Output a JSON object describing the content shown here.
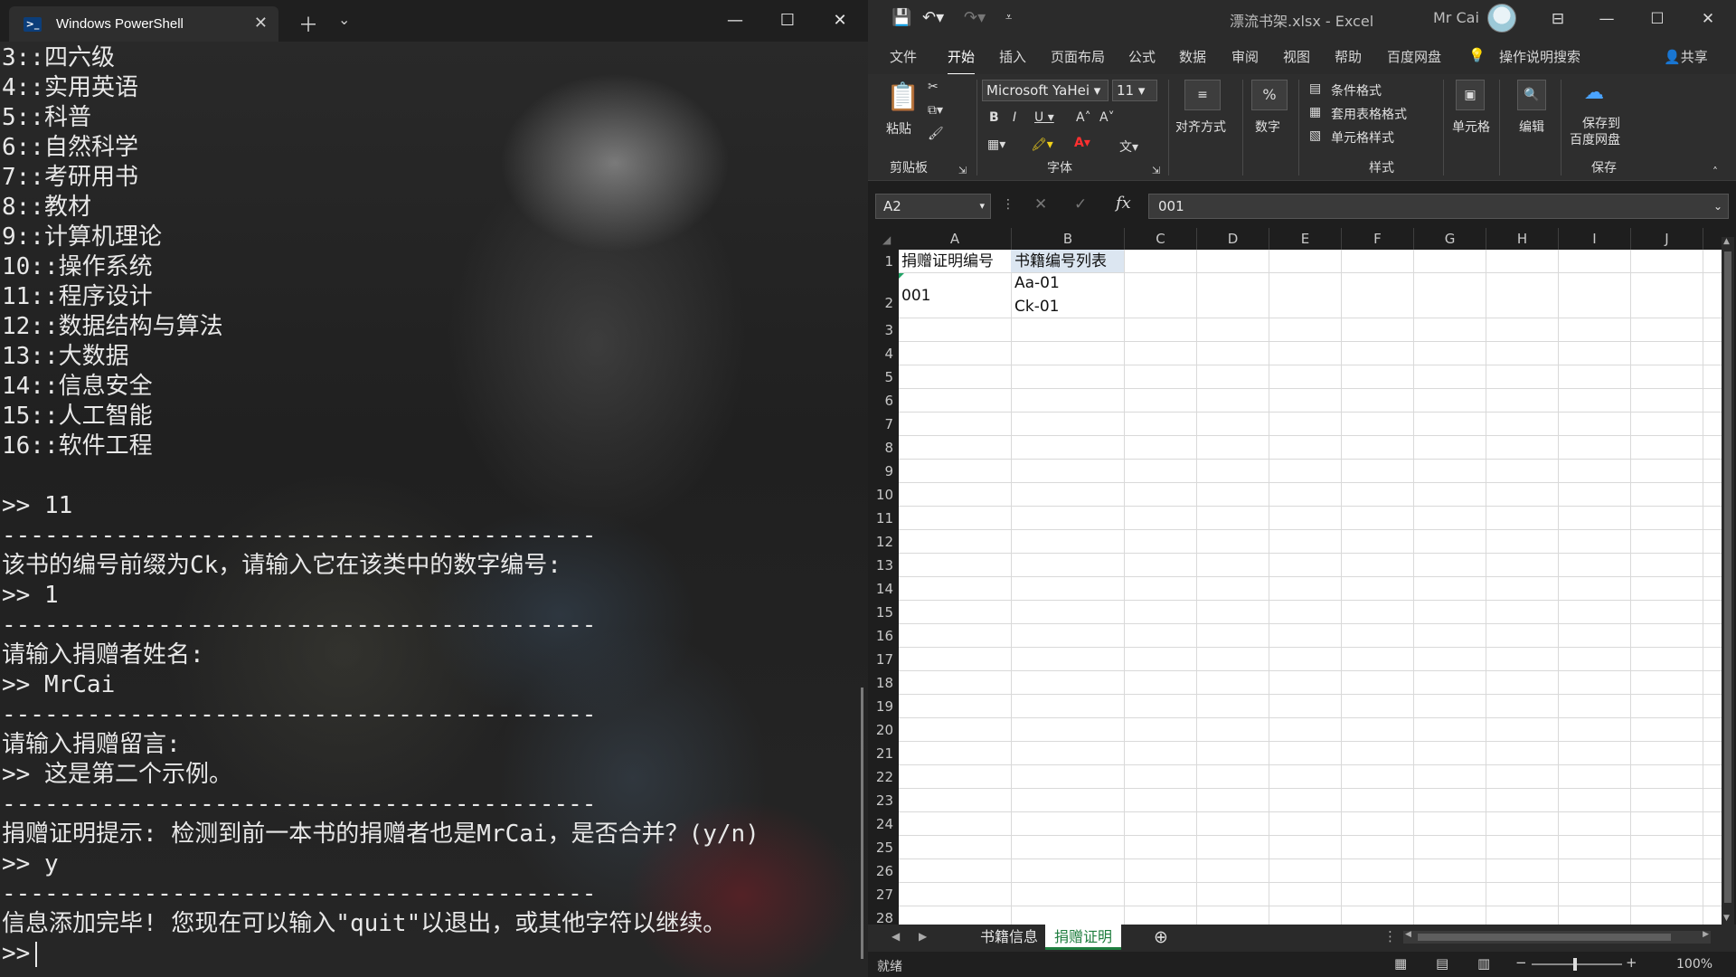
{
  "powershell": {
    "tab_title": "Windows PowerShell",
    "lines": [
      "3::四六级",
      "4::实用英语",
      "5::科普",
      "6::自然科学",
      "7::考研用书",
      "8::教材",
      "9::计算机理论",
      "10::操作系统",
      "11::程序设计",
      "12::数据结构与算法",
      "13::大数据",
      "14::信息安全",
      "15::人工智能",
      "16::软件工程",
      "",
      ">> 11",
      "------------------------------------------",
      "该书的编号前缀为Ck，请输入它在该类中的数字编号:",
      ">> 1",
      "------------------------------------------",
      "请输入捐赠者姓名:",
      ">> MrCai",
      "------------------------------------------",
      "请输入捐赠留言:",
      ">> 这是第二个示例。",
      "------------------------------------------",
      "捐赠证明提示: 检测到前一本书的捐赠者也是MrCai，是否合并？(y/n)",
      ">> y",
      "------------------------------------------",
      "信息添加完毕! 您现在可以输入\"quit\"以退出，或其他字符以继续。"
    ],
    "prompt": ">>"
  },
  "excel": {
    "filename": "漂流书架.xlsx - Excel",
    "user": "Mr Cai",
    "menu": [
      "文件",
      "开始",
      "插入",
      "页面布局",
      "公式",
      "数据",
      "审阅",
      "视图",
      "帮助",
      "百度网盘"
    ],
    "tell_me": "操作说明搜索",
    "share": "共享",
    "ribbon": {
      "paste": "粘贴",
      "clipboard_group": "剪贴板",
      "font_name": "Microsoft YaHei",
      "font_size": "11",
      "font_group": "字体",
      "align": "对齐方式",
      "number": "数字",
      "cond_format": "条件格式",
      "table_format": "套用表格格式",
      "cell_style": "单元格样式",
      "style_group": "样式",
      "cells": "单元格",
      "edit": "编辑",
      "save_to_line1": "保存到",
      "save_to_line2": "百度网盘",
      "save_group": "保存"
    },
    "namebox": "A2",
    "formula_value": "001",
    "columns": [
      "A",
      "B",
      "C",
      "D",
      "E",
      "F",
      "G",
      "H",
      "I",
      "J"
    ],
    "rows": [
      "1",
      "2",
      "3",
      "4",
      "5",
      "6",
      "7",
      "8",
      "9",
      "10",
      "11",
      "12",
      "13",
      "14",
      "15",
      "16",
      "17",
      "18",
      "19",
      "20",
      "21",
      "22",
      "23",
      "24",
      "25",
      "26",
      "27",
      "28"
    ],
    "cells": {
      "A1": "捐赠证明编号",
      "B1": "书籍编号列表",
      "A2": "001",
      "B2_line1": "Aa-01",
      "B2_line2": "Ck-01"
    },
    "sheets": [
      "书籍信息",
      "捐赠证明"
    ],
    "active_sheet": "捐赠证明",
    "status": "就绪",
    "zoom": "100%"
  }
}
